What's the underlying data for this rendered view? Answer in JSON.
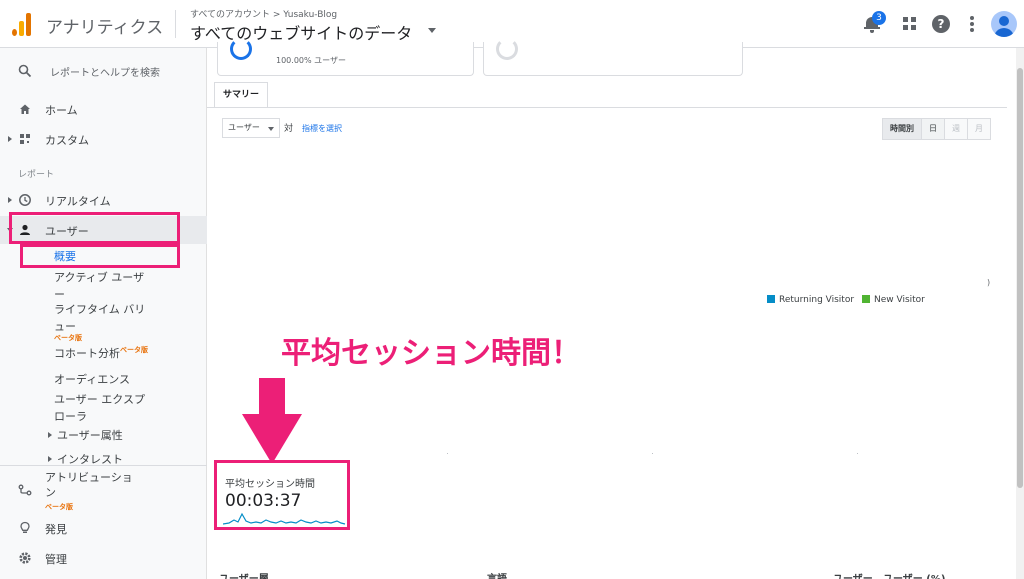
{
  "header": {
    "app_name": "アナリティクス",
    "breadcrumb": "すべてのアカウント > Yusaku-Blog",
    "view_title": "すべてのウェブサイトのデータ",
    "notification_count": "3",
    "help_glyph": "?"
  },
  "sidebar": {
    "search_label": "レポートとヘルプを検索",
    "home": "ホーム",
    "custom": "カスタム",
    "reports_section": "レポート",
    "realtime": "リアルタイム",
    "audience": "ユーザー",
    "sub_items": {
      "overview": "概要",
      "active_users_1": "アクティブ ユーザ",
      "active_users_2": "ー",
      "lifetime_1": "ライフタイム バリ",
      "lifetime_2": "ュー",
      "cohort": "コホート分析",
      "audiences": "オーディエンス",
      "explorer_1": "ユーザー エクスプ",
      "explorer_2": "ローラ",
      "attributes": "ユーザー属性",
      "interests": "インタレスト"
    },
    "beta": "ベータ版",
    "attribution_1": "アトリビューショ",
    "attribution_2": "ン",
    "discover": "発見",
    "admin": "管理"
  },
  "content": {
    "segment_sub": "100.00% ユーザー",
    "tab_summary": "サマリー",
    "metric_select": "ユーザー",
    "vs": "対",
    "pick_metric": "指標を選択",
    "periods": [
      "時間別",
      "日",
      "週",
      "月"
    ],
    "legend": [
      {
        "name": "Returning Visitor",
        "color": "#058dc7"
      },
      {
        "name": "New Visitor",
        "color": "#50b432"
      }
    ],
    "annotation": "平均セッション時間！",
    "metric_title": "平均セッション時間",
    "metric_value": "00:03:37",
    "bottom_headers": [
      "ユーザー層",
      "言語",
      "ユーザー",
      "ユーザー (%)"
    ]
  },
  "colors": {
    "highlight": "#ec1f77",
    "accent": "#1a73e8"
  }
}
